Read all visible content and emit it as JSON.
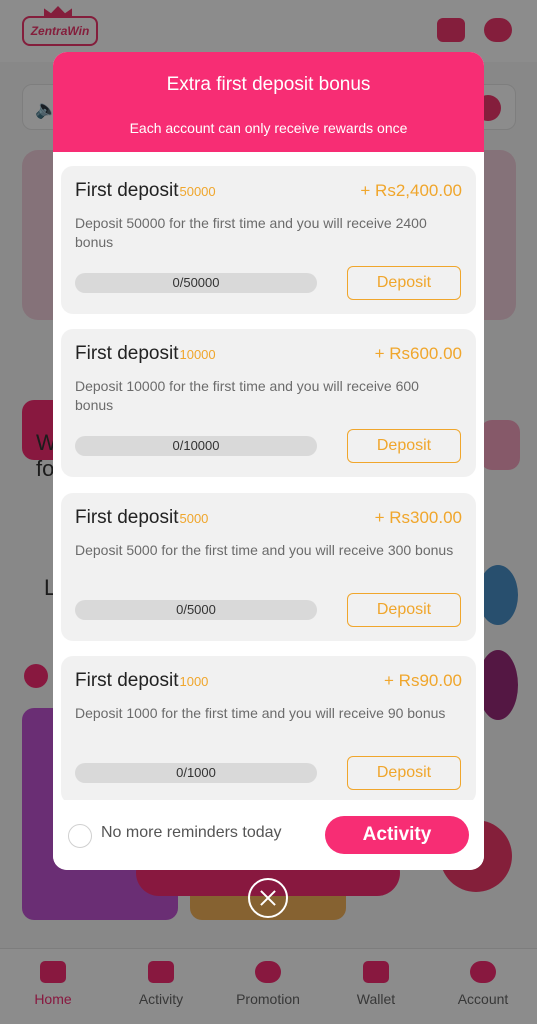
{
  "app": {
    "logo_text": "ZentraWin",
    "brand_color": "#f72d74",
    "accent_color": "#f0a62c"
  },
  "bottom_nav": [
    {
      "label": "Home",
      "icon": "gamepad-icon",
      "active": true
    },
    {
      "label": "Activity",
      "icon": "gift-icon",
      "active": false
    },
    {
      "label": "Promotion",
      "icon": "diamond-icon",
      "active": false
    },
    {
      "label": "Wallet",
      "icon": "wallet-icon",
      "active": false
    },
    {
      "label": "Account",
      "icon": "user-icon",
      "active": false
    }
  ],
  "modal": {
    "title": "Extra first deposit bonus",
    "subtitle": "Each account can only receive rewards once",
    "cards": [
      {
        "title": "First deposit",
        "amount": "50000",
        "reward": "+ Rs2,400.00",
        "description": "Deposit 50000 for the first time and you will receive 2400 bonus",
        "progress_text": "0/50000",
        "progress_fraction": 0,
        "button_label": "Deposit"
      },
      {
        "title": "First deposit",
        "amount": "10000",
        "reward": "+ Rs600.00",
        "description": "Deposit 10000 for the first time and you will receive 600 bonus",
        "progress_text": "0/10000",
        "progress_fraction": 0,
        "button_label": "Deposit"
      },
      {
        "title": "First deposit",
        "amount": "5000",
        "reward": "+ Rs300.00",
        "description": "Deposit 5000 for the first time and you will receive 300 bonus",
        "progress_text": "0/5000",
        "progress_fraction": 0,
        "button_label": "Deposit"
      },
      {
        "title": "First deposit",
        "amount": "1000",
        "reward": "+ Rs90.00",
        "description": "Deposit 1000 for the first time and you will receive 90 bonus",
        "progress_text": "0/1000",
        "progress_fraction": 0,
        "button_label": "Deposit"
      }
    ],
    "footer": {
      "reminder_text": "No more reminders today",
      "reminder_checked": false,
      "activity_label": "Activity"
    }
  }
}
